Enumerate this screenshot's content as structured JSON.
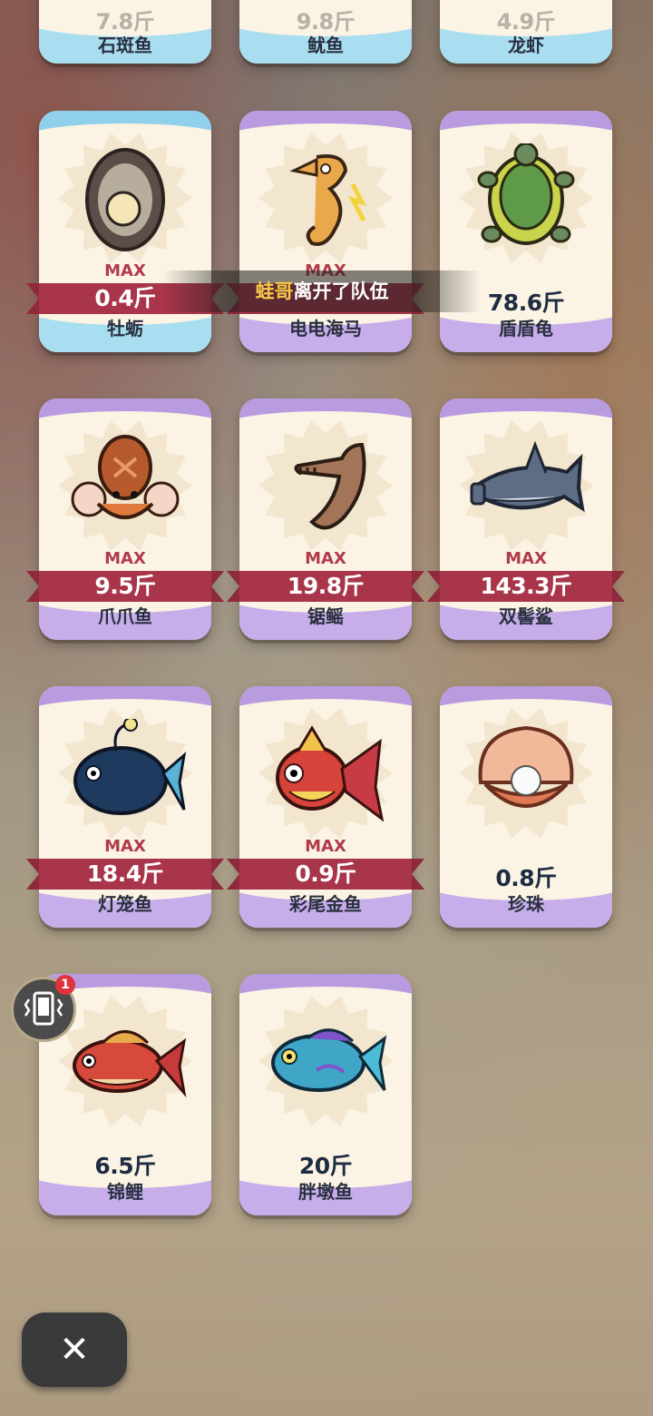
{
  "toast": {
    "nickname": "蛙哥",
    "message": "离开了队伍"
  },
  "max_label": "MAX",
  "close_symbol": "✕",
  "notification_count": "1",
  "top_row": [
    {
      "weight": "7.8斤",
      "name": "石斑鱼"
    },
    {
      "weight": "9.8斤",
      "name": "鱿鱼"
    },
    {
      "weight": "4.9斤",
      "name": "龙虾"
    }
  ],
  "cards": [
    {
      "name": "牡蛎",
      "weight": "0.4斤",
      "max": true,
      "theme": "blue",
      "icon": "oyster-icon"
    },
    {
      "name": "电电海马",
      "weight": "",
      "max": true,
      "theme": "purple",
      "icon": "seahorse-icon"
    },
    {
      "name": "盾盾龟",
      "weight": "78.6斤",
      "max": false,
      "theme": "purple",
      "icon": "turtle-icon"
    },
    {
      "name": "爪爪鱼",
      "weight": "9.5斤",
      "max": true,
      "theme": "purple",
      "icon": "octopus-icon"
    },
    {
      "name": "锯鳐",
      "weight": "19.8斤",
      "max": true,
      "theme": "purple",
      "icon": "sawfish-icon"
    },
    {
      "name": "双髻鲨",
      "weight": "143.3斤",
      "max": true,
      "theme": "purple",
      "icon": "hammerhead-icon"
    },
    {
      "name": "灯笼鱼",
      "weight": "18.4斤",
      "max": true,
      "theme": "purple",
      "icon": "anglerfish-icon"
    },
    {
      "name": "彩尾金鱼",
      "weight": "0.9斤",
      "max": true,
      "theme": "purple",
      "icon": "goldfish-icon"
    },
    {
      "name": "珍珠",
      "weight": "0.8斤",
      "max": false,
      "theme": "purple",
      "icon": "pearl-icon"
    },
    {
      "name": "锦鲤",
      "weight": "6.5斤",
      "max": false,
      "theme": "purple",
      "icon": "koi-icon"
    },
    {
      "name": "胖墩鱼",
      "weight": "20斤",
      "max": false,
      "theme": "purple",
      "icon": "parrotfish-icon"
    }
  ]
}
